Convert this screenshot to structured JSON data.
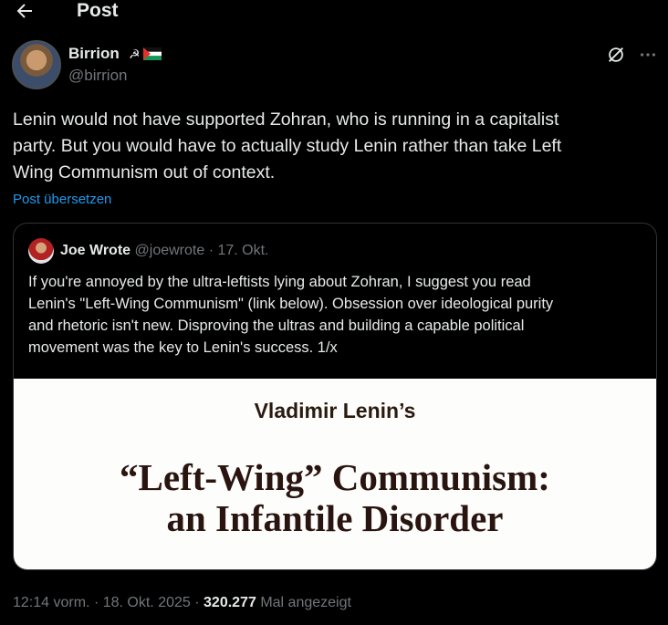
{
  "header": {
    "title": "Post",
    "back_icon": "arrow-left-icon"
  },
  "author": {
    "name": "Birrion",
    "emoji": "☭",
    "flag": "palestine-flag",
    "handle": "@birrion"
  },
  "post": {
    "text": "Lenin would not have supported Zohran, who is running in a capitalist\nparty. But you would have to actually study Lenin rather than take Left\nWing Communism out of context.",
    "translate_label": "Post übersetzen"
  },
  "quote": {
    "name": "Joe Wrote",
    "handle": "@joewrote",
    "sep": "·",
    "date": "17. Okt.",
    "text": "If you're annoyed by the ultra-leftists lying about Zohran, I suggest you read\nLenin's \"Left-Wing Communism\" (link below). Obsession over ideological purity\nand rhetoric isn't new. Disproving the ultras and building a capable political\nmovement was the key to Lenin's success. 1/x",
    "image": {
      "author_line": "Vladimir Lenin’s",
      "title": "“Left-Wing” Communism:\nan Infantile Disorder"
    }
  },
  "footer": {
    "time": "12:14 vorm.",
    "sep": "·",
    "date": "18. Okt. 2025",
    "views": "320.277",
    "views_label": "Mal angezeigt"
  },
  "colors": {
    "background": "#000000",
    "text": "#e7e9ea",
    "muted": "#71767b",
    "link": "#1d9bf0",
    "border": "#2f3336"
  }
}
